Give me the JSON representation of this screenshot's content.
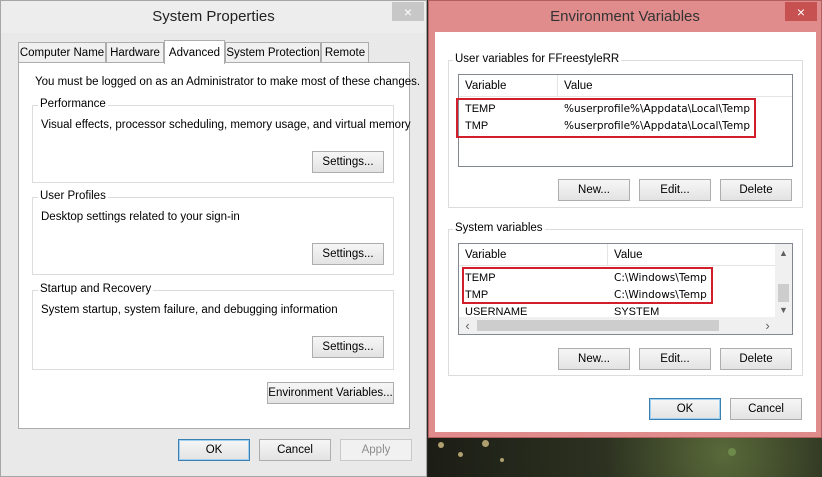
{
  "system_properties": {
    "title": "System Properties",
    "tabs": [
      "Computer Name",
      "Hardware",
      "Advanced",
      "System Protection",
      "Remote"
    ],
    "active_tab": "Advanced",
    "admin_note": "You must be logged on as an Administrator to make most of these changes.",
    "performance": {
      "title": "Performance",
      "description": "Visual effects, processor scheduling, memory usage, and virtual memory",
      "button": "Settings..."
    },
    "user_profiles": {
      "title": "User Profiles",
      "description": "Desktop settings related to your sign-in",
      "button": "Settings..."
    },
    "startup_recovery": {
      "title": "Startup and Recovery",
      "description": "System startup, system failure, and debugging information",
      "button": "Settings..."
    },
    "env_button": "Environment Variables...",
    "ok": "OK",
    "cancel": "Cancel",
    "apply": "Apply"
  },
  "environment_variables": {
    "title": "Environment Variables",
    "user_section": {
      "title": "User variables for FFreestyleRR",
      "columns": [
        "Variable",
        "Value"
      ],
      "rows": [
        {
          "variable": "TEMP",
          "value": "%userprofile%\\Appdata\\Local\\Temp"
        },
        {
          "variable": "TMP",
          "value": "%userprofile%\\Appdata\\Local\\Temp"
        }
      ],
      "buttons": {
        "new": "New...",
        "edit": "Edit...",
        "delete": "Delete"
      }
    },
    "system_section": {
      "title": "System variables",
      "columns": [
        "Variable",
        "Value"
      ],
      "rows": [
        {
          "variable": "TEMP",
          "value": "C:\\Windows\\Temp"
        },
        {
          "variable": "TMP",
          "value": "C:\\Windows\\Temp"
        },
        {
          "variable": "USERNAME",
          "value": "SYSTEM"
        }
      ],
      "buttons": {
        "new": "New...",
        "edit": "Edit...",
        "delete": "Delete"
      }
    },
    "ok": "OK",
    "cancel": "Cancel"
  },
  "colors": {
    "highlight_box": "#d21e2b",
    "env_frame": "#e08c8c",
    "default_button_border": "#3c7fb1"
  },
  "icons": {
    "close": "×",
    "scroll_up": "▲",
    "scroll_down": "▼",
    "scroll_left": "‹",
    "scroll_right": "›"
  }
}
